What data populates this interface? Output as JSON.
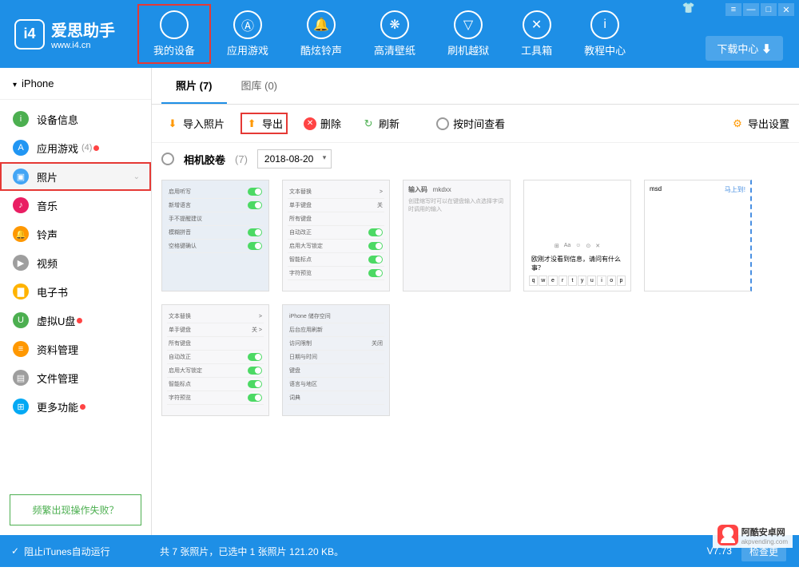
{
  "logo": {
    "badge": "i4",
    "title": "爱思助手",
    "sub": "www.i4.cn"
  },
  "nav": [
    {
      "icon": "",
      "label": "我的设备",
      "hl": true
    },
    {
      "icon": "Ⓐ",
      "label": "应用游戏"
    },
    {
      "icon": "🔔",
      "label": "酷炫铃声"
    },
    {
      "icon": "❋",
      "label": "高清壁纸"
    },
    {
      "icon": "▽",
      "label": "刷机越狱"
    },
    {
      "icon": "✕",
      "label": "工具箱"
    },
    {
      "icon": "i",
      "label": "教程中心"
    }
  ],
  "download_label": "下载中心 ⬇",
  "device_name": "iPhone",
  "sidebar": [
    {
      "label": "设备信息",
      "color": "#4caf50",
      "icon": "i"
    },
    {
      "label": "应用游戏",
      "color": "#2196f3",
      "icon": "A",
      "badge": "(4)",
      "dot": true
    },
    {
      "label": "照片",
      "color": "#42a5f5",
      "icon": "▣",
      "hl": true,
      "chev": true
    },
    {
      "label": "音乐",
      "color": "#e91e63",
      "icon": "♪"
    },
    {
      "label": "铃声",
      "color": "#ff9800",
      "icon": "🔔"
    },
    {
      "label": "视频",
      "color": "#9e9e9e",
      "icon": "▶"
    },
    {
      "label": "电子书",
      "color": "#ffb300",
      "icon": "▇"
    },
    {
      "label": "虚拟U盘",
      "color": "#4caf50",
      "icon": "U",
      "dot": true
    },
    {
      "label": "资料管理",
      "color": "#ff9800",
      "icon": "≡"
    },
    {
      "label": "文件管理",
      "color": "#9e9e9e",
      "icon": "▤"
    },
    {
      "label": "更多功能",
      "color": "#03a9f4",
      "icon": "⊞",
      "dot": true
    }
  ],
  "help_text": "频繁出现操作失败？",
  "tabs": [
    {
      "label": "照片 (7)",
      "active": true
    },
    {
      "label": "图库 (0)"
    }
  ],
  "toolbar": {
    "import": "导入照片",
    "export": "导出",
    "delete": "删除",
    "refresh": "刷新",
    "by_time": "按时间查看",
    "settings": "导出设置"
  },
  "filter": {
    "album": "相机胶卷",
    "count": "(7)",
    "date": "2018-08-20"
  },
  "thumbs_settings": [
    [
      "启用听写",
      ""
    ],
    [
      "新增语言",
      ""
    ],
    [
      "手不提醒建议",
      ""
    ],
    [
      "模糊拼音",
      ""
    ],
    [
      "空格键确认",
      ""
    ]
  ],
  "thumbs_settings2": [
    [
      "文本替换",
      ">"
    ],
    [
      "单手键盘",
      "关"
    ],
    [
      "所有键盘",
      ""
    ],
    [
      "自动改正",
      ""
    ],
    [
      "启用大写锁定",
      ""
    ],
    [
      "智能标点",
      ""
    ],
    [
      "字符预览",
      ""
    ]
  ],
  "thumbs_input": {
    "title": "输入码",
    "val": "mkdxx",
    "desc": "创建缩写时可以在键盘输入点选择字词时调用的输入"
  },
  "thumbs_kb": {
    "note": "欧刚才没看到信息，请问有什么事？",
    "keys": [
      "q",
      "w",
      "e",
      "r",
      "t",
      "y",
      "u",
      "i",
      "o",
      "p"
    ]
  },
  "thumbs_msd": {
    "left": "msd",
    "right": "马上到!"
  },
  "thumbs_settings3": [
    [
      "文本替换",
      ">"
    ],
    [
      "单手键盘",
      "关 >"
    ],
    [
      "所有键盘",
      ""
    ],
    [
      "自动改正",
      ""
    ],
    [
      "启用大写锁定",
      ""
    ],
    [
      "智能标点",
      ""
    ],
    [
      "字符预览",
      ""
    ]
  ],
  "thumbs_settings4": [
    [
      "iPhone 储存空间",
      ""
    ],
    [
      "后台应用刷新",
      ""
    ],
    [
      "访问限制",
      "关闭"
    ],
    [
      "日期与时间",
      ""
    ],
    [
      "键盘",
      ""
    ],
    [
      "语言与地区",
      ""
    ],
    [
      "词典",
      ""
    ]
  ],
  "footer": {
    "itunes": "阻止iTunes自动运行",
    "status": "共 7 张照片，已选中 1 张照片 121.20 KB。",
    "version": "V7.73",
    "check": "检查更"
  },
  "watermark": {
    "name": "阿酷安卓网",
    "url": "akpvending.com"
  }
}
